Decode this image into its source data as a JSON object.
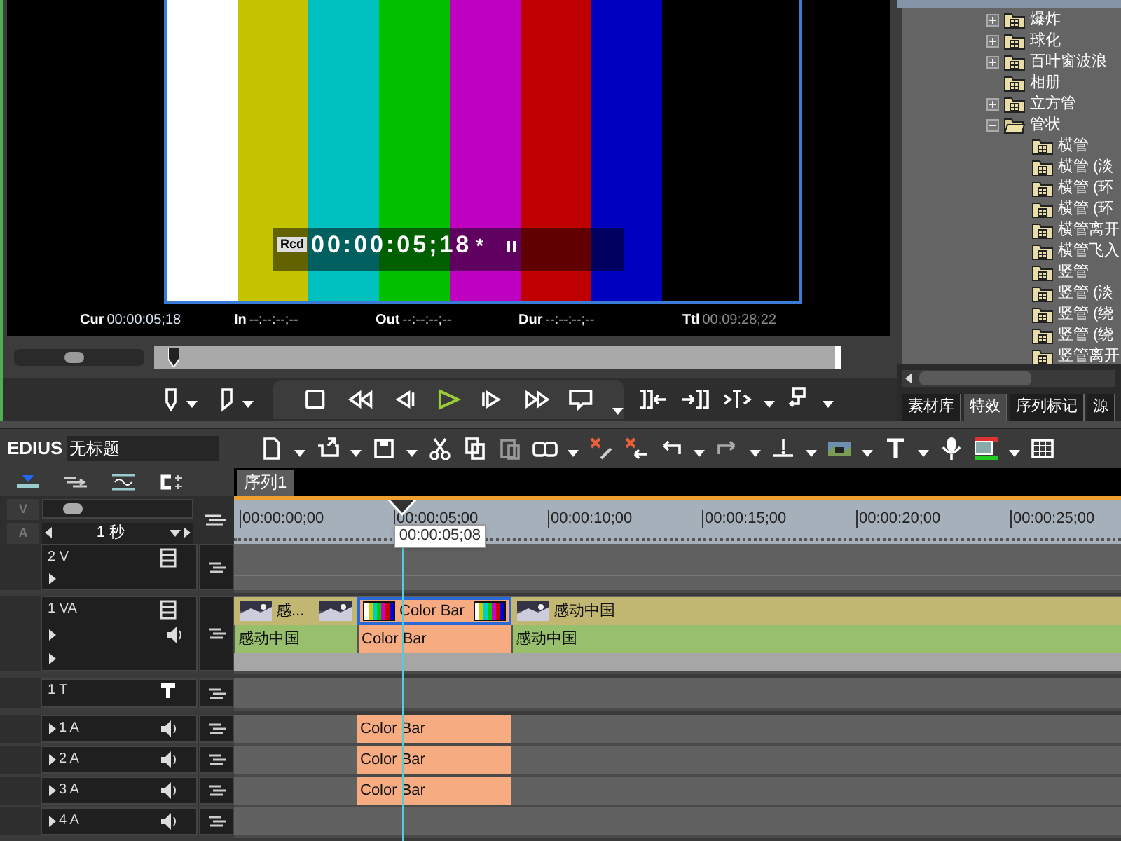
{
  "monitor": {
    "overlay": {
      "label": "Rcd",
      "timecode": "00:00:05;18",
      "flag": "*"
    },
    "info": [
      {
        "label": "Cur",
        "value": "00:00:05;18",
        "dimmed": false
      },
      {
        "label": "In",
        "value": "--:--:--;--",
        "dimmed": false
      },
      {
        "label": "Out",
        "value": "--:--:--;--",
        "dimmed": false
      },
      {
        "label": "Dur",
        "value": "--:--:--;--",
        "dimmed": false
      },
      {
        "label": "Ttl",
        "value": "00:09:28;22",
        "dimmed": true
      }
    ],
    "zoom_slider": {
      "level": 0.45
    },
    "scrubber": {
      "level": 0.02
    }
  },
  "tree": [
    {
      "label": "爆炸",
      "expanded": false
    },
    {
      "label": "球化",
      "expanded": false
    },
    {
      "label": "百叶窗波浪",
      "expanded": false
    },
    {
      "label": "相册"
    },
    {
      "label": "立方管",
      "expanded": false
    },
    {
      "label": "管状",
      "expanded": true,
      "children": [
        {
          "label": "横管"
        },
        {
          "label": "横管 (淡"
        },
        {
          "label": "横管 (环"
        },
        {
          "label": "横管 (环"
        },
        {
          "label": "横管离开"
        },
        {
          "label": "横管飞入"
        },
        {
          "label": "竖管"
        },
        {
          "label": "竖管 (淡"
        },
        {
          "label": "竖管 (绕"
        },
        {
          "label": "竖管 (绕"
        },
        {
          "label": "竖管离开"
        }
      ]
    }
  ],
  "panel_tabs": [
    {
      "label": "素材库",
      "selected": false
    },
    {
      "label": "特效",
      "selected": true
    },
    {
      "label": "序列标记",
      "selected": false
    },
    {
      "label": "源",
      "selected": false
    }
  ],
  "app_name": "EDIUS",
  "project_name": "无标题",
  "sequence_tab": {
    "label": "序列1",
    "selected": true
  },
  "track_panel": {
    "lock_labels": [
      "V",
      "A"
    ],
    "slider": {
      "level": 0.15
    },
    "zoom": "1 秒"
  },
  "ruler": [
    "00:00:00;00",
    "00:00:05;00",
    "00:00:10;00",
    "00:00:15;00",
    "00:00:20;00",
    "00:00:25;00"
  ],
  "playhead": "00:00:05;08",
  "tracks": [
    {
      "name": "2 V",
      "kind": "video"
    },
    {
      "name": "1 VA",
      "kind": "va",
      "clips": [
        {
          "kind": "movie",
          "label": "感...",
          "audio_label": "感动中国",
          "selected": false,
          "end_thumb": true
        },
        {
          "kind": "colorbar",
          "label": "Color Bar",
          "audio_label": "Color Bar",
          "selected": true,
          "end_thumb": true
        },
        {
          "kind": "movie",
          "label": "感动中国",
          "audio_label": "感动中国",
          "selected": false
        }
      ]
    },
    {
      "name": "1 T",
      "kind": "title"
    },
    {
      "name": "1 A",
      "kind": "audio",
      "clips": [
        {
          "kind": "colorbar",
          "label": "Color Bar"
        }
      ]
    },
    {
      "name": "2 A",
      "kind": "audio",
      "clips": [
        {
          "kind": "colorbar",
          "label": "Color Bar"
        }
      ]
    },
    {
      "name": "3 A",
      "kind": "audio",
      "clips": [
        {
          "kind": "colorbar",
          "label": "Color Bar"
        }
      ]
    },
    {
      "name": "4 A",
      "kind": "audio"
    }
  ]
}
